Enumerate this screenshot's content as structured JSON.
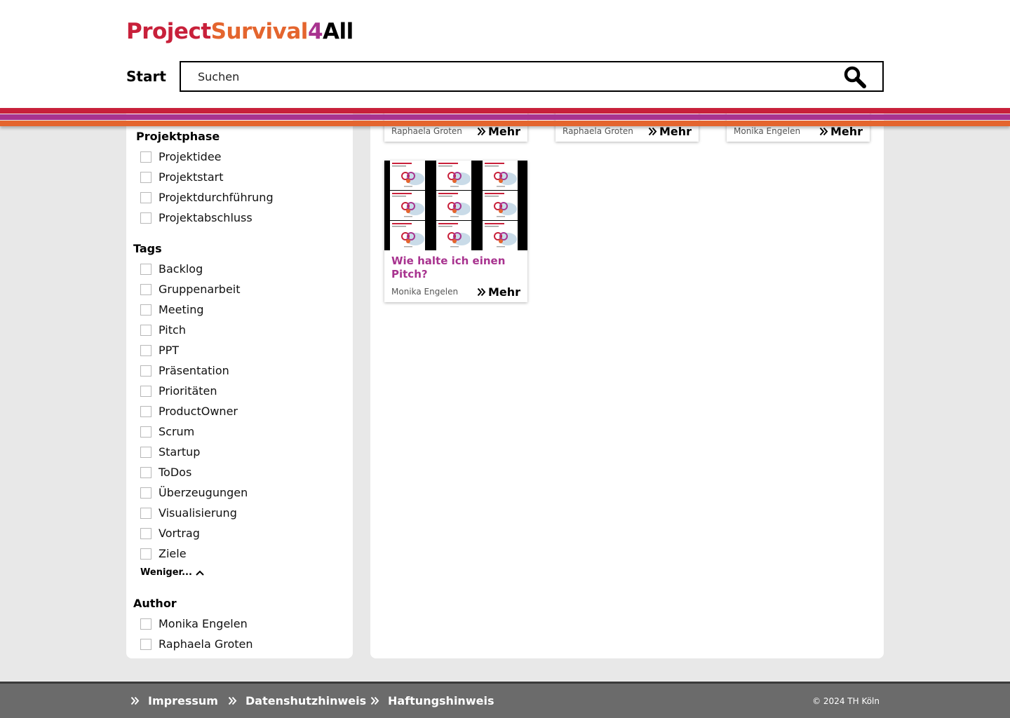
{
  "header": {
    "logo_parts": [
      {
        "text": "Project",
        "color": "#c8203a"
      },
      {
        "text": "Survival",
        "color": "#e4652e"
      },
      {
        "text": "4",
        "color": "#a8338f"
      },
      {
        "text": "All",
        "color": "#000000"
      }
    ],
    "start_label": "Start",
    "search_placeholder": "Suchen",
    "stripe_colors": [
      "#c8203a",
      "#a8338f",
      "#e4652e"
    ]
  },
  "sidebar": {
    "facets": [
      {
        "title": "Projektphase",
        "items": [
          "Projektidee",
          "Projektstart",
          "Projektdurchführung",
          "Projektabschluss"
        ]
      },
      {
        "title": "Tags",
        "items": [
          "Backlog",
          "Gruppenarbeit",
          "Meeting",
          "Pitch",
          "PPT",
          "Präsentation",
          "Prioritäten",
          "ProductOwner",
          "Scrum",
          "Startup",
          "ToDos",
          "Überzeugungen",
          "Visualisierung",
          "Vortrag",
          "Ziele"
        ]
      },
      {
        "title": "Author",
        "items": [
          "Monika Engelen",
          "Raphaela Groten"
        ]
      }
    ],
    "less_label": "Weniger..."
  },
  "main": {
    "more_label": "Mehr",
    "cards_top_row": [
      {
        "author": "Raphaela Groten"
      },
      {
        "author": "Raphaela Groten"
      },
      {
        "author": "Monika Engelen"
      }
    ],
    "card_full": {
      "title": "Wie halte ich einen Pitch?",
      "author": "Monika Engelen"
    }
  },
  "footer": {
    "links": [
      "Impressum",
      "Datenshutzhinweis",
      "Haftungshinweis"
    ],
    "copyright": "© 2024 TH Köln"
  }
}
